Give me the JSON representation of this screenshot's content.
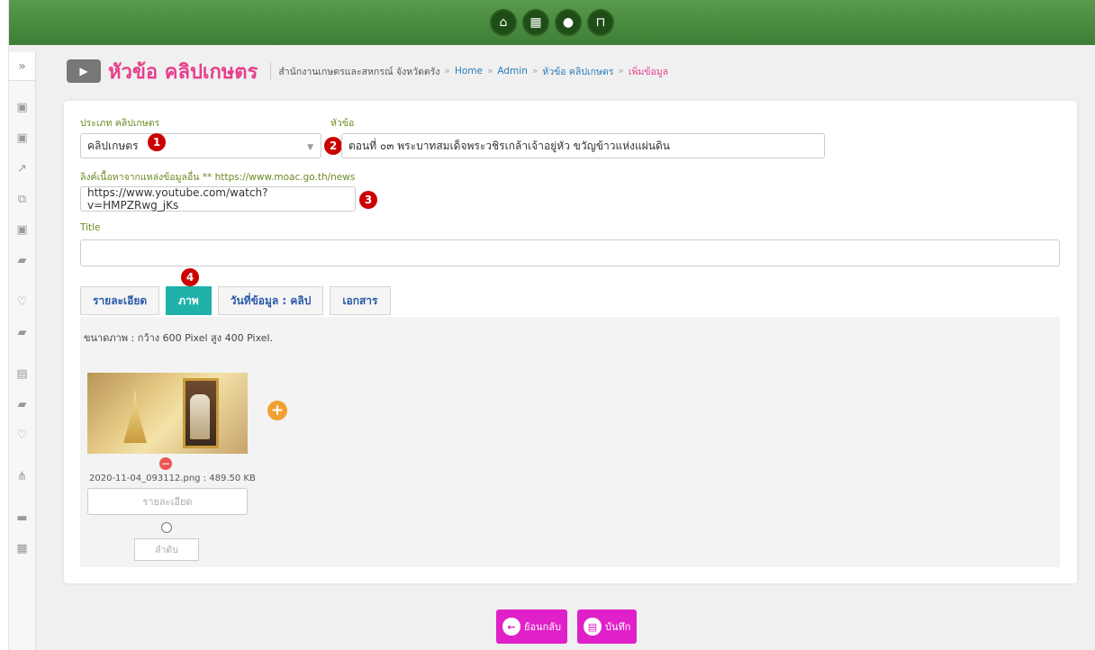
{
  "topbar": {
    "buttons": [
      {
        "icon": "home-icon",
        "glyph": "⌂"
      },
      {
        "icon": "grid-icon",
        "glyph": "▦"
      },
      {
        "icon": "user-icon",
        "glyph": "●"
      },
      {
        "icon": "unlock-icon",
        "glyph": "⊓"
      }
    ]
  },
  "sidebar": {
    "toggle": "»",
    "items": [
      {
        "icon": "image-icon",
        "glyph": "▣"
      },
      {
        "icon": "image-icon",
        "glyph": "▣"
      },
      {
        "icon": "external-link-icon",
        "glyph": "↗"
      },
      {
        "icon": "copy-icon",
        "glyph": "⧉"
      },
      {
        "icon": "image-icon",
        "glyph": "▣"
      },
      {
        "icon": "book-icon",
        "glyph": "▰"
      },
      {
        "icon": "heart-image-icon",
        "glyph": "♡"
      },
      {
        "icon": "book-icon",
        "glyph": "▰"
      },
      {
        "icon": "images-icon",
        "glyph": "▤"
      },
      {
        "icon": "book-icon",
        "glyph": "▰"
      },
      {
        "icon": "heart-icon",
        "glyph": "♡"
      },
      {
        "icon": "sitemap-icon",
        "glyph": "⋔"
      },
      {
        "icon": "archive-icon",
        "glyph": "▬"
      },
      {
        "icon": "calendar-icon",
        "glyph": "▦"
      }
    ]
  },
  "header": {
    "title": "หัวข้อ คลิปเกษตร",
    "breadcrumb": {
      "org": "สำนักงานเกษตรและสหกรณ์ จังหวัดตรัง",
      "sep": "»",
      "home": "Home",
      "admin": "Admin",
      "section": "หัวข้อ คลิปเกษตร",
      "current": "เพิ่มข้อมูล"
    }
  },
  "form": {
    "type_label": "ประเภท คลิปเกษตร",
    "type_value": "คลิปเกษตร",
    "topic_label": "หัวข้อ",
    "topic_value": "ตอนที่ ๐๓ พระบาทสมเด็จพระวชิรเกล้าเจ้าอยู่หัว ขวัญข้าวแห่งแผ่นดิน",
    "link_label": "ลิงค์เนื้อหาจากแหล่งข้อมูลอื่น ** https://www.moac.go.th/news",
    "link_value": "https://www.youtube.com/watch?v=HMPZRwg_jKs",
    "title_label": "Title",
    "title_value": ""
  },
  "markers": [
    "1",
    "2",
    "3",
    "4"
  ],
  "tabs": [
    {
      "label": "รายละเอียด",
      "active": false
    },
    {
      "label": "ภาพ",
      "active": true
    },
    {
      "label": "วันที่ข้อมูล : คลิป",
      "active": false
    },
    {
      "label": "เอกสาร",
      "active": false
    }
  ],
  "image_tab": {
    "size_note": "ขนาดภาพ : กว้าง 600 Pixel สูง 400 Pixel.",
    "file_info": "2020-11-04_093112.png : 489.50 KB",
    "desc_placeholder": "รายละเอียด",
    "order_placeholder": "ลำดับ",
    "remove_glyph": "−",
    "add_glyph": "+"
  },
  "actions": {
    "back_label": "ย้อนกลับ",
    "back_glyph": "←",
    "save_label": "บันทึก",
    "save_glyph": "▤"
  },
  "colors": {
    "topbar": "#4a8a3e",
    "title": "#e83e8c",
    "label": "#6a8a1f",
    "tab_active": "#20b2aa",
    "action": "#e020c8",
    "marker": "#cc0000"
  }
}
